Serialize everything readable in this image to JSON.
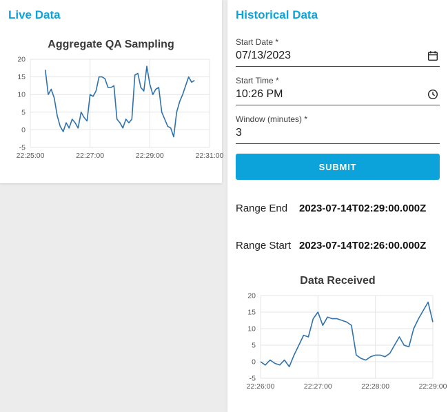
{
  "theme": {
    "accent": "#0ba3da",
    "line_color": "#2f71ab",
    "grid_color": "#e5e5e5",
    "tick_color": "#555555",
    "background": "#ececec",
    "card_background": "#ffffff"
  },
  "live_panel": {
    "title": "Live Data"
  },
  "historical_panel": {
    "title": "Historical Data",
    "form": {
      "start_date": {
        "label": "Start Date *",
        "value": "07/13/2023"
      },
      "start_time": {
        "label": "Start Time *",
        "value": "10:26 PM"
      },
      "window": {
        "label": "Window (minutes) *",
        "value": "3"
      },
      "submit_label": "SUBMIT"
    },
    "range_end": {
      "label": "Range End",
      "value": "2023-07-14T02:29:00.000Z"
    },
    "range_start": {
      "label": "Range Start",
      "value": "2023-07-14T02:26:00.000Z"
    }
  },
  "chart_data": [
    {
      "type": "line",
      "title": "Aggregate QA Sampling",
      "xlabel": "",
      "ylabel": "",
      "legend": "off",
      "grid": "on",
      "x_unit": "seconds after 22:25:00",
      "xlim": [
        0,
        360
      ],
      "ylim": [
        -5,
        20
      ],
      "x_tick_positions": [
        0,
        120,
        240,
        360
      ],
      "x_tick_labels": [
        "22:25:00",
        "22:27:00",
        "22:29:00",
        "22:31:00"
      ],
      "y_ticks": [
        -5,
        0,
        5,
        10,
        15,
        20
      ],
      "x": [
        30,
        36,
        42,
        48,
        54,
        60,
        66,
        72,
        78,
        84,
        90,
        96,
        102,
        108,
        114,
        120,
        126,
        132,
        138,
        144,
        150,
        156,
        162,
        168,
        174,
        180,
        186,
        192,
        198,
        204,
        210,
        216,
        222,
        228,
        234,
        240,
        246,
        252,
        258,
        264,
        270,
        276,
        282,
        288,
        294,
        300,
        306,
        312,
        318,
        324,
        330
      ],
      "values": [
        17,
        10,
        11.5,
        9,
        4,
        1,
        -0.5,
        2,
        0.5,
        3,
        2,
        0.5,
        5,
        3.5,
        2.5,
        10,
        9.5,
        11,
        15,
        15,
        14.5,
        12,
        12,
        12.5,
        3,
        2,
        0.5,
        3,
        2,
        3,
        15.5,
        16,
        12,
        11,
        18,
        13,
        10,
        11.5,
        12,
        5,
        3,
        1,
        0.5,
        -2,
        5,
        8,
        10,
        12.5,
        15,
        13.5,
        14
      ]
    },
    {
      "type": "line",
      "title": "Data Received",
      "xlabel": "",
      "ylabel": "",
      "legend": "off",
      "grid": "on",
      "x_unit": "seconds after 22:26:00",
      "xlim": [
        0,
        180
      ],
      "ylim": [
        -5,
        20
      ],
      "x_tick_positions": [
        0,
        60,
        120,
        180
      ],
      "x_tick_labels": [
        "22:26:00",
        "22:27:00",
        "22:28:00",
        "22:29:00"
      ],
      "y_ticks": [
        -5,
        0,
        5,
        10,
        15,
        20
      ],
      "x": [
        0,
        5,
        10,
        15,
        20,
        25,
        30,
        35,
        40,
        45,
        50,
        55,
        60,
        65,
        70,
        75,
        80,
        85,
        90,
        95,
        100,
        105,
        110,
        115,
        120,
        125,
        130,
        135,
        140,
        145,
        150,
        155,
        160,
        165,
        170,
        175,
        180
      ],
      "values": [
        0,
        -1,
        0.5,
        -0.5,
        -1,
        0.5,
        -1.5,
        2,
        5,
        8,
        7.5,
        13,
        15,
        11,
        13.5,
        13,
        13,
        12.5,
        12,
        11,
        2,
        1,
        0.5,
        1.5,
        2,
        2,
        1.5,
        2.5,
        5,
        7.5,
        5,
        4.5,
        10,
        13,
        15.5,
        18,
        12
      ]
    }
  ]
}
